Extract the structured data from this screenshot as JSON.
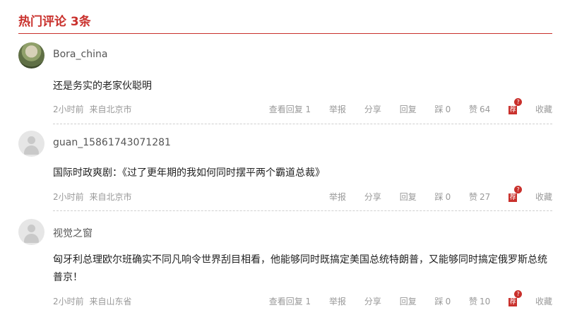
{
  "section": {
    "title": "热门评论 3条"
  },
  "comments": [
    {
      "user": "Bora_china",
      "text": "还是务实的老家伙聪明",
      "time": "2小时前",
      "location": "来自北京市",
      "view_replies": "查看回复 1",
      "report": "举报",
      "share": "分享",
      "reply": "回复",
      "dislike_label": "踩",
      "dislike_count": "0",
      "like_label": "赞",
      "like_count": "64",
      "recommend_label": "荐",
      "collect": "收藏"
    },
    {
      "user": "guan_15861743071281",
      "text": "国际时政爽剧：《过了更年期的我如何同时摆平两个霸道总裁》",
      "time": "2小时前",
      "location": "来自北京市",
      "report": "举报",
      "share": "分享",
      "reply": "回复",
      "dislike_label": "踩",
      "dislike_count": "0",
      "like_label": "赞",
      "like_count": "27",
      "recommend_label": "荐",
      "collect": "收藏"
    },
    {
      "user": "视觉之窗",
      "text": "匈牙利总理欧尔班确实不同凡响令世界刮目相看，他能够同时既搞定美国总统特朗普，又能够同时搞定俄罗斯总统普京！",
      "time": "2小时前",
      "location": "来自山东省",
      "view_replies": "查看回复 1",
      "report": "举报",
      "share": "分享",
      "reply": "回复",
      "dislike_label": "踩",
      "dislike_count": "0",
      "like_label": "赞",
      "like_count": "10",
      "recommend_label": "荐",
      "collect": "收藏"
    }
  ],
  "colors": {
    "accent": "#c9302c",
    "muted": "#999999"
  },
  "icons": {
    "default_avatar": "user-silhouette-icon",
    "recommend": "recommend-badge-icon"
  }
}
